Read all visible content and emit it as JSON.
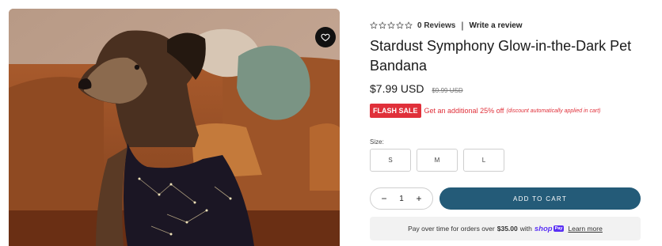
{
  "product": {
    "image_alt": "Dog wearing a black constellation print bandana sitting on a sofa",
    "wishlist_icon": "heart-icon",
    "reviews_label": "0 Reviews",
    "review_separator": "|",
    "write_review_label": "Write a review",
    "title": "Stardust Symphony Glow-in-the-Dark Pet Bandana",
    "price": "$7.99 USD",
    "compare_price": "$9.99 USD"
  },
  "promo": {
    "badge": "FLASH SALE",
    "text": "Get an additional 25% off",
    "note": "(discount automatically applied in cart)",
    "color": "#e0303a"
  },
  "size": {
    "label": "Size:",
    "options": [
      "S",
      "M",
      "L"
    ]
  },
  "cart": {
    "minus": "−",
    "quantity": "1",
    "plus": "+",
    "add_to_cart_label": "ADD TO CART",
    "button_color": "#245b78"
  },
  "payment": {
    "prefix": "Pay over time for orders over",
    "threshold": "$35.00",
    "with": "with",
    "shop_word": "shop",
    "pay_word": "Pay",
    "learn_more": "Learn more",
    "brand_color": "#5a31f4"
  }
}
